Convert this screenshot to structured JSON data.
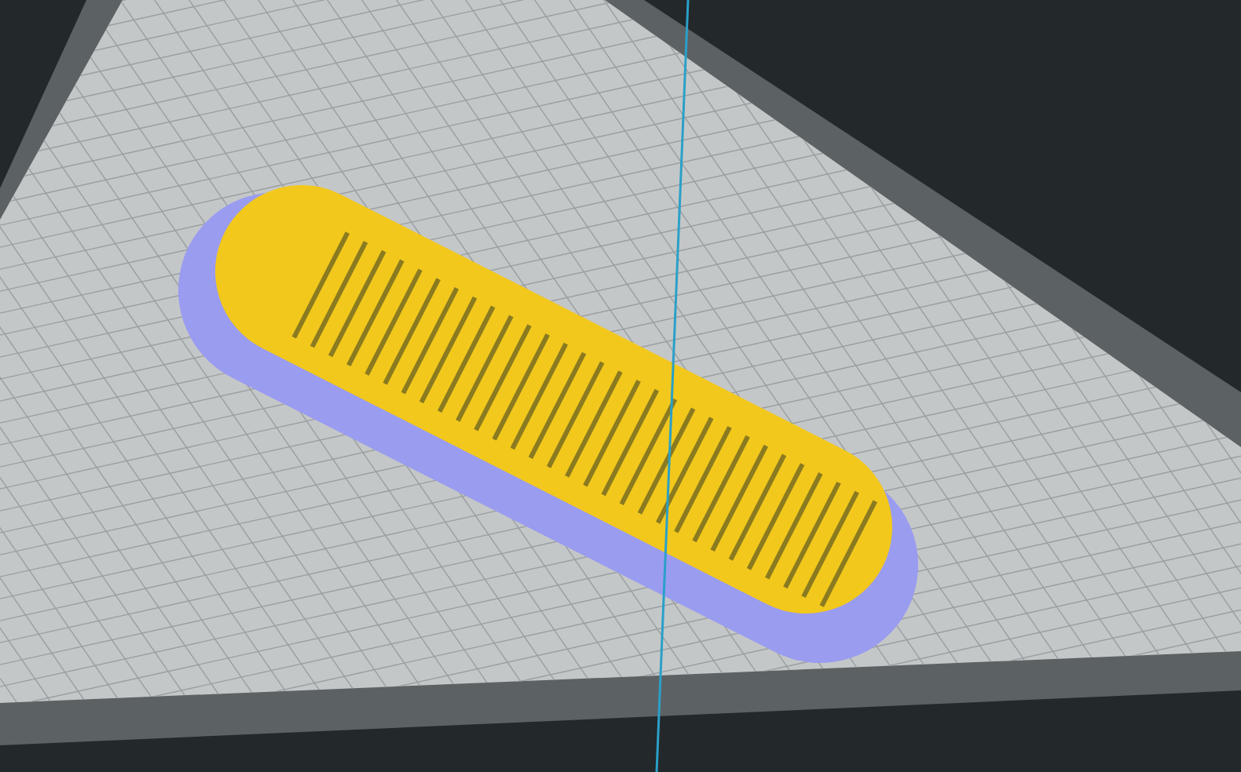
{
  "viewport": {
    "axis_visible": true
  }
}
